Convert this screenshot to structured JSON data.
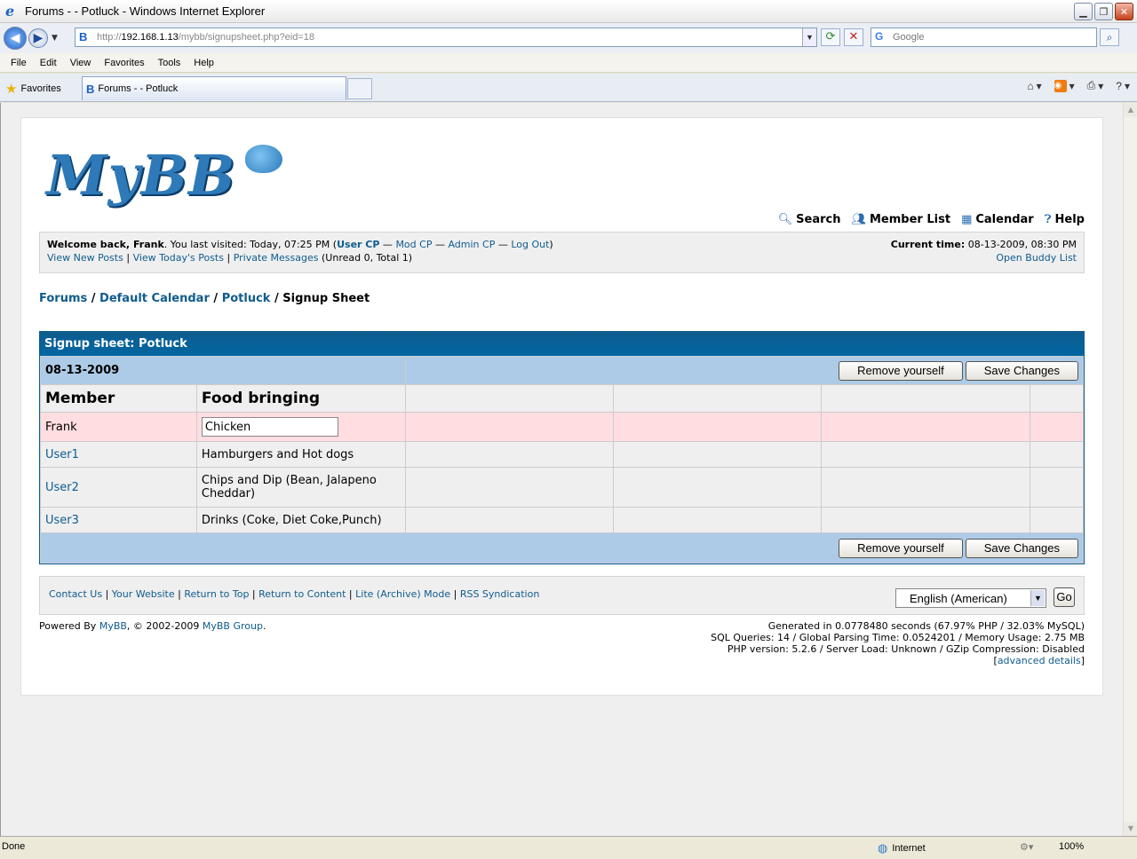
{
  "window": {
    "title": "Forums - - Potluck - Windows Internet Explorer"
  },
  "address": {
    "url_prefix": "http://",
    "url_host": "192.168.1.13",
    "url_path": "/mybb/signupsheet.php?eid=18",
    "search_placeholder": "Google"
  },
  "menu": [
    "File",
    "Edit",
    "View",
    "Favorites",
    "Tools",
    "Help"
  ],
  "tabs": {
    "favorites_label": "Favorites",
    "active_tab": "Forums - - Potluck"
  },
  "site": {
    "logo_text": "MyBB",
    "top_links": [
      "Search",
      "Member List",
      "Calendar",
      "Help"
    ],
    "welcome": {
      "prefix": "Welcome back, ",
      "user": "Frank",
      "last_visit": ". You last visited: Today, 07:25 PM (",
      "user_cp": "User CP",
      "sep": " — ",
      "mod_cp": "Mod CP",
      "admin_cp": "Admin CP",
      "log_out": "Log Out",
      "close": ")"
    },
    "quick_links": {
      "new_posts": "View New Posts",
      "todays_posts": "View Today's Posts",
      "pm": "Private Messages",
      "pm_counts": "(Unread 0, Total 1)",
      "divider": "|"
    },
    "current_time_label": "Current time:",
    "current_time": "08-13-2009, 08:30 PM",
    "buddy_list": "Open Buddy List"
  },
  "breadcrumb": [
    "Forums",
    "Default Calendar",
    "Potluck",
    "Signup Sheet"
  ],
  "signup": {
    "title": "Signup sheet: Potluck",
    "date": "08-13-2009",
    "remove_label": "Remove yourself",
    "save_label": "Save Changes",
    "col_member": "Member",
    "col_food": "Food bringing",
    "me": {
      "member": "Frank",
      "food": "Chicken"
    },
    "rows": [
      {
        "member": "User1",
        "food": "Hamburgers and Hot dogs"
      },
      {
        "member": "User2",
        "food": "Chips and Dip (Bean, Jalapeno Cheddar)"
      },
      {
        "member": "User3",
        "food": "Drinks (Coke, Diet Coke,Punch)"
      }
    ]
  },
  "footer": {
    "links": [
      "Contact Us",
      "Your Website",
      "Return to Top",
      "Return to Content",
      "Lite (Archive) Mode",
      "RSS Syndication"
    ],
    "language": "English (American)",
    "go": "Go",
    "powered_prefix": "Powered By ",
    "powered_mybb": "MyBB",
    "powered_mid": ", © 2002-2009 ",
    "powered_group": "MyBB Group",
    "powered_end": ".",
    "debug_lines": [
      "Generated in 0.0778480 seconds (67.97% PHP / 32.03% MySQL)",
      "SQL Queries: 14 / Global Parsing Time: 0.0524201 / Memory Usage: 2.75 MB",
      "PHP version: 5.2.6 / Server Load: Unknown / GZip Compression: Disabled"
    ],
    "advanced_details": "advanced details"
  },
  "status": {
    "done": "Done",
    "zone": "Internet",
    "zoom": "100%"
  },
  "colors": {
    "link": "#0f5c8e",
    "thead": "#0f5c8e",
    "tcat": "#adcbe7",
    "my_row": "#ffdde0"
  }
}
